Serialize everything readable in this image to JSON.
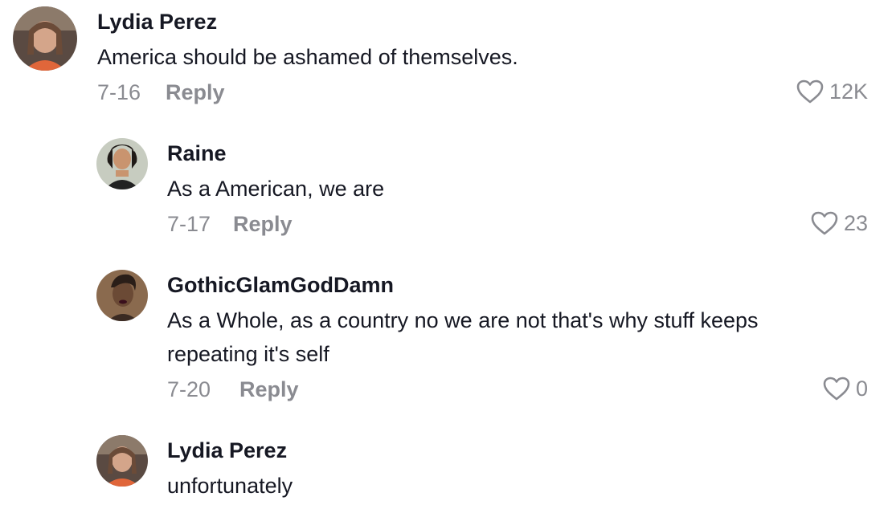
{
  "comments": [
    {
      "username": "Lydia Perez",
      "text": "America should be ashamed of themselves.",
      "date": "7-16",
      "reply_label": "Reply",
      "likes": "12K",
      "avatar_icon": "user-avatar-photo"
    },
    {
      "username": "Raine",
      "text": "As a American, we are",
      "date": "7-17",
      "reply_label": "Reply",
      "likes": "23",
      "avatar_icon": "user-avatar-photo"
    },
    {
      "username": "GothicGlamGodDamn",
      "text": "As a Whole, as a country no we are not that's why stuff keeps repeating it's self",
      "date": "7-20",
      "reply_label": "Reply",
      "likes": "0",
      "avatar_icon": "user-avatar-photo"
    },
    {
      "username": "Lydia Perez",
      "text": "unfortunately",
      "avatar_icon": "user-avatar-photo"
    }
  ],
  "colors": {
    "text_primary": "#161823",
    "text_secondary": "#8a8b91",
    "background": "#ffffff"
  },
  "icons": {
    "like": "heart-outline-icon"
  }
}
